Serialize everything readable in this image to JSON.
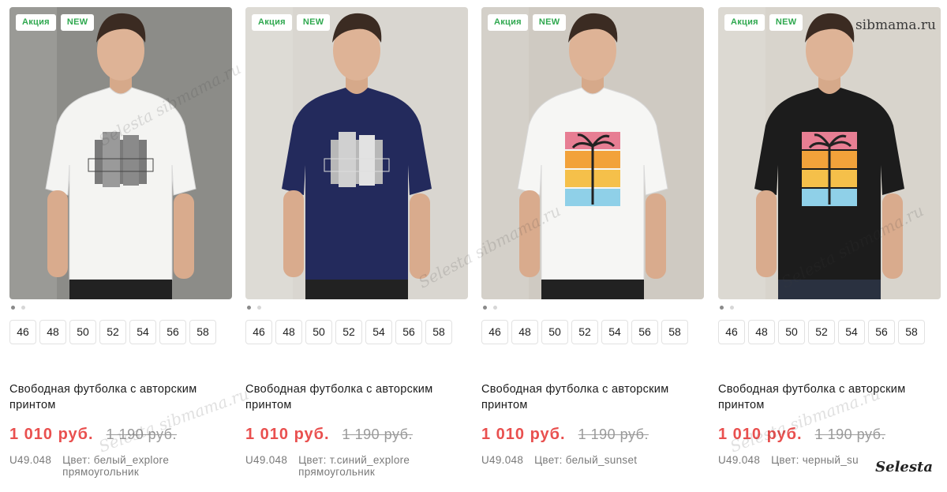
{
  "products": [
    {
      "badges": [
        "Акция",
        "NEW"
      ],
      "sizes": [
        "46",
        "48",
        "50",
        "52",
        "54",
        "56",
        "58"
      ],
      "title": "Свободная футболка с авторским принтом",
      "price": "1 010 руб.",
      "old_price": "1 190 руб.",
      "article": "U49.048",
      "color": "Цвет: белый_explore прямоугольник",
      "shirt_color": "#f4f4f2",
      "bg_color": "#8c8c88",
      "print_style": "explore"
    },
    {
      "badges": [
        "Акция",
        "NEW"
      ],
      "sizes": [
        "46",
        "48",
        "50",
        "52",
        "54",
        "56",
        "58"
      ],
      "title": "Свободная футболка с авторским принтом",
      "price": "1 010 руб.",
      "old_price": "1 190 руб.",
      "article": "U49.048",
      "color": "Цвет: т.синий_explore прямоугольник",
      "shirt_color": "#232a5c",
      "bg_color": "#d9d6d0",
      "print_style": "explore"
    },
    {
      "badges": [
        "Акция",
        "NEW"
      ],
      "sizes": [
        "46",
        "48",
        "50",
        "52",
        "54",
        "56",
        "58"
      ],
      "title": "Свободная футболка с авторским принтом",
      "price": "1 010 руб.",
      "old_price": "1 190 руб.",
      "article": "U49.048",
      "color": "Цвет: белый_sunset",
      "shirt_color": "#f6f6f4",
      "bg_color": "#cfcac2",
      "print_style": "sunset"
    },
    {
      "badges": [
        "Акция",
        "NEW"
      ],
      "sizes": [
        "46",
        "48",
        "50",
        "52",
        "54",
        "56",
        "58"
      ],
      "title": "Свободная футболка с авторским принтом",
      "price": "1 010 руб.",
      "old_price": "1 190 руб.",
      "article": "U49.048",
      "color": "Цвет: черный_su",
      "shirt_color": "#1c1c1c",
      "bg_color": "#d8d4cc",
      "print_style": "sunset"
    }
  ],
  "watermark": {
    "site": "sibmama.ru",
    "brand": "Selesta",
    "text": "Selesta sibmama.ru"
  }
}
